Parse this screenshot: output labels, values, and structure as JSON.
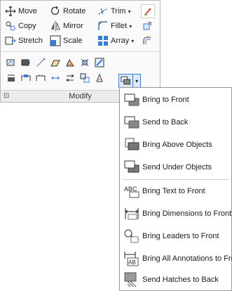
{
  "ribbon": {
    "panel_title": "Modify",
    "row1": [
      {
        "label": "Move",
        "icon": "move-icon"
      },
      {
        "label": "Rotate",
        "icon": "rotate-icon"
      },
      {
        "label": "Trim",
        "icon": "trim-icon"
      }
    ],
    "row2": [
      {
        "label": "Copy",
        "icon": "copy-icon"
      },
      {
        "label": "Mirror",
        "icon": "mirror-icon"
      },
      {
        "label": "Fillet",
        "icon": "fillet-icon"
      }
    ],
    "row3": [
      {
        "label": "Stretch",
        "icon": "stretch-icon"
      },
      {
        "label": "Scale",
        "icon": "scale-icon"
      },
      {
        "label": "Array",
        "icon": "array-icon"
      }
    ],
    "dropdown_glyph": "▾",
    "pin_glyph": "⊡"
  },
  "draworder_menu": {
    "items": [
      {
        "label": "Bring to Front",
        "icon": "bring-to-front-icon"
      },
      {
        "label": "Send to Back",
        "icon": "send-to-back-icon"
      },
      {
        "label": "Bring Above Objects",
        "icon": "bring-above-objects-icon"
      },
      {
        "label": "Send Under Objects",
        "icon": "send-under-objects-icon"
      },
      {
        "label": "Bring Text to Front",
        "icon": "bring-text-to-front-icon"
      },
      {
        "label": "Bring Dimensions to Front",
        "icon": "bring-dimensions-to-front-icon"
      },
      {
        "label": "Bring Leaders to Front",
        "icon": "bring-leaders-to-front-icon"
      },
      {
        "label": "Bring All Annotations to Front",
        "icon": "bring-all-annotations-to-front-icon"
      },
      {
        "label": "Send Hatches to Back",
        "icon": "send-hatches-to-back-icon"
      }
    ]
  },
  "colors": {
    "accent": "#3a7bd5",
    "menu_border": "#9a9a9a"
  }
}
